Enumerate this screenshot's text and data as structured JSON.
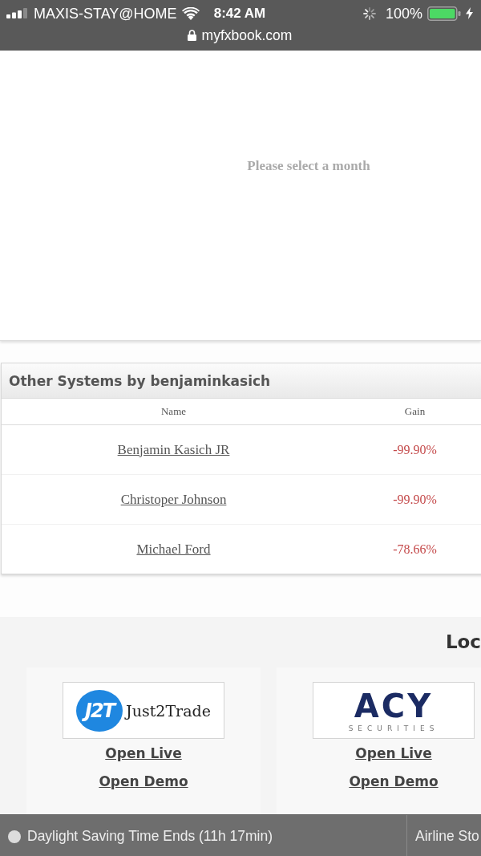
{
  "status_bar": {
    "carrier": "MAXIS-STAY@HOME",
    "time": "8:42 AM",
    "battery": "100%",
    "url": "myfxbook.com"
  },
  "chart_panel": {
    "message": "Please select a month"
  },
  "systems_panel": {
    "title": "Other Systems by benjaminkasich",
    "columns": [
      "Name",
      "Gain"
    ],
    "rows": [
      {
        "name": "Benjamin Kasich JR",
        "gain": "-99.90%"
      },
      {
        "name": "Christoper Johnson",
        "gain": "-99.90%"
      },
      {
        "name": "Michael Ford",
        "gain": "-78.66%"
      }
    ]
  },
  "brokers": {
    "heading": "Loc",
    "cards": [
      {
        "logo": {
          "kind": "j2t",
          "mark": "J2T",
          "text": "Just2Trade"
        },
        "links": [
          "Open Live",
          "Open Demo"
        ]
      },
      {
        "logo": {
          "kind": "acy",
          "mark": "ACY",
          "text": "SECURITIES"
        },
        "links": [
          "Open Live",
          "Open Demo"
        ]
      }
    ]
  },
  "ticker": {
    "items": [
      "Daylight Saving Time Ends (11h 17min)",
      "Airline Sto"
    ]
  }
}
